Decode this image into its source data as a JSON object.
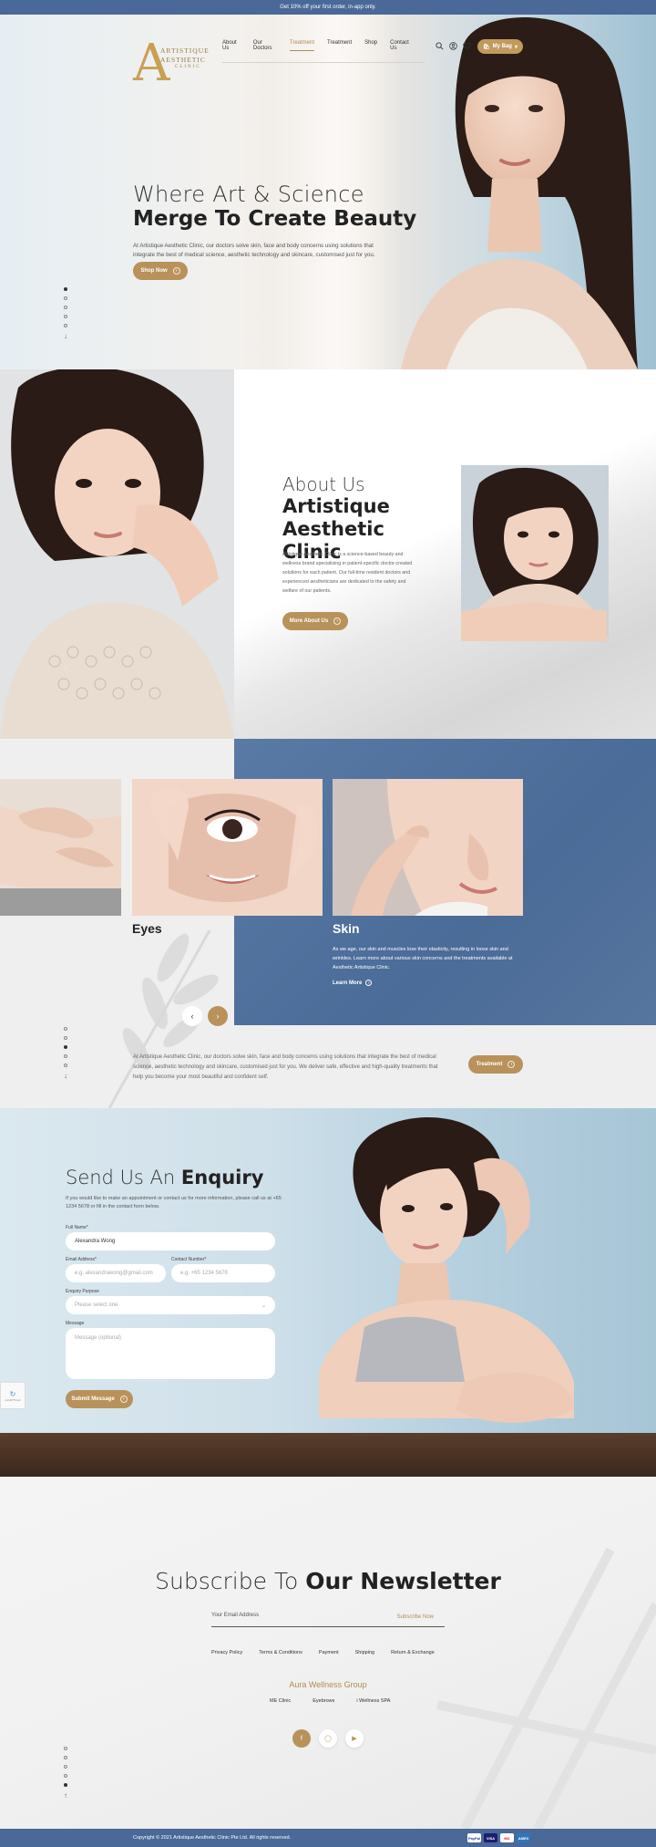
{
  "topbar": {
    "text": "Get 10% off your first order, in-app only."
  },
  "logo": {
    "letter": "A",
    "line1": "ARTISTIQUE",
    "line2": "AESTHETIC",
    "line3": "CLINIC"
  },
  "nav": {
    "items": [
      "About Us",
      "Our Doctors",
      "Treatment",
      "Treatment",
      "Shop",
      "Contact Us"
    ],
    "my_bag": "My Bag"
  },
  "hero": {
    "title_line1": "Where Art & Science",
    "title_line2": "Merge To Create Beauty",
    "description": "At Artistique Aesthetic Clinic, our doctors solve skin, face and body concerns using solutions that integrate the best of medical science, aesthetic technology and skincare, customised just for you.",
    "button": "Shop Now"
  },
  "about": {
    "title_line1": "About Us",
    "title_line2": "Artistique Aesthetic Clinic",
    "description": "Artistique Aesthetic Clinic is a science-based beauty and wellness brand specialising in patient-specific doctor-created solutions for each patient. Our full-time resident doctors and experienced aestheticians are dedicated to the safety and welfare of our patients.",
    "button": "More About Us"
  },
  "treatments": {
    "cards": [
      {
        "label": ""
      },
      {
        "label": "Eyes"
      },
      {
        "label": "Skin"
      }
    ],
    "skin_description": "As we age, our skin and muscles lose their elasticity, resulting in loose skin and wrinkles. Learn more about various skin concerns and the treatments available at Aesthetic Artistique Clinic.",
    "learn_more": "Learn More",
    "description": "At Artistique Aesthetic Clinic, our doctors solve skin, face and body concerns using solutions that integrate the best of medical science, aesthetic technology and skincare, customised just for you. We deliver safe, effective and high-quality treatments that help you become your most beautiful and confident self.",
    "button": "Treatment"
  },
  "enquiry": {
    "title_light": "Send Us An ",
    "title_bold": "Enquiry",
    "subtitle": "If you would like to make an appointment or contact us for more information, please call us at +65 1234 5678 or fill in the contact form below.",
    "full_name_label": "Full Name*",
    "full_name_value": "Alexandra Wong",
    "email_label": "Email Address*",
    "email_placeholder": "e.g. alexandrawong@gmail.com",
    "contact_label": "Contact Number*",
    "contact_placeholder": "e.g. +65 1234 5678",
    "purpose_label": "Enquiry Purpose",
    "purpose_placeholder": "Please select one",
    "message_label": "Message",
    "message_placeholder": "Message (optional)",
    "submit": "Submit Message",
    "recaptcha": "reCAPTCHA"
  },
  "newsletter": {
    "title_light": "Subscribe To ",
    "title_bold": "Our Newsletter",
    "email_placeholder": "Your Email Address",
    "subscribe": "Subscribe Now"
  },
  "footer": {
    "links": [
      "Privacy Policy",
      "Terms & Conditions",
      "Payment",
      "Shipping",
      "Return & Exchange"
    ],
    "group_title": "Aura Wellness Group",
    "group_links": [
      "ME Clinic",
      "Eyebrows",
      "i Wellness SPA"
    ],
    "copyright": "Copyright © 2021 Artistique Aesthetic Clinic Pte Ltd. All rights reserved.",
    "payments": [
      "PayPal",
      "VISA",
      "MC",
      "AMEX"
    ]
  },
  "colors": {
    "brand_blue": "#4a6898",
    "gold": "#b8925a"
  }
}
